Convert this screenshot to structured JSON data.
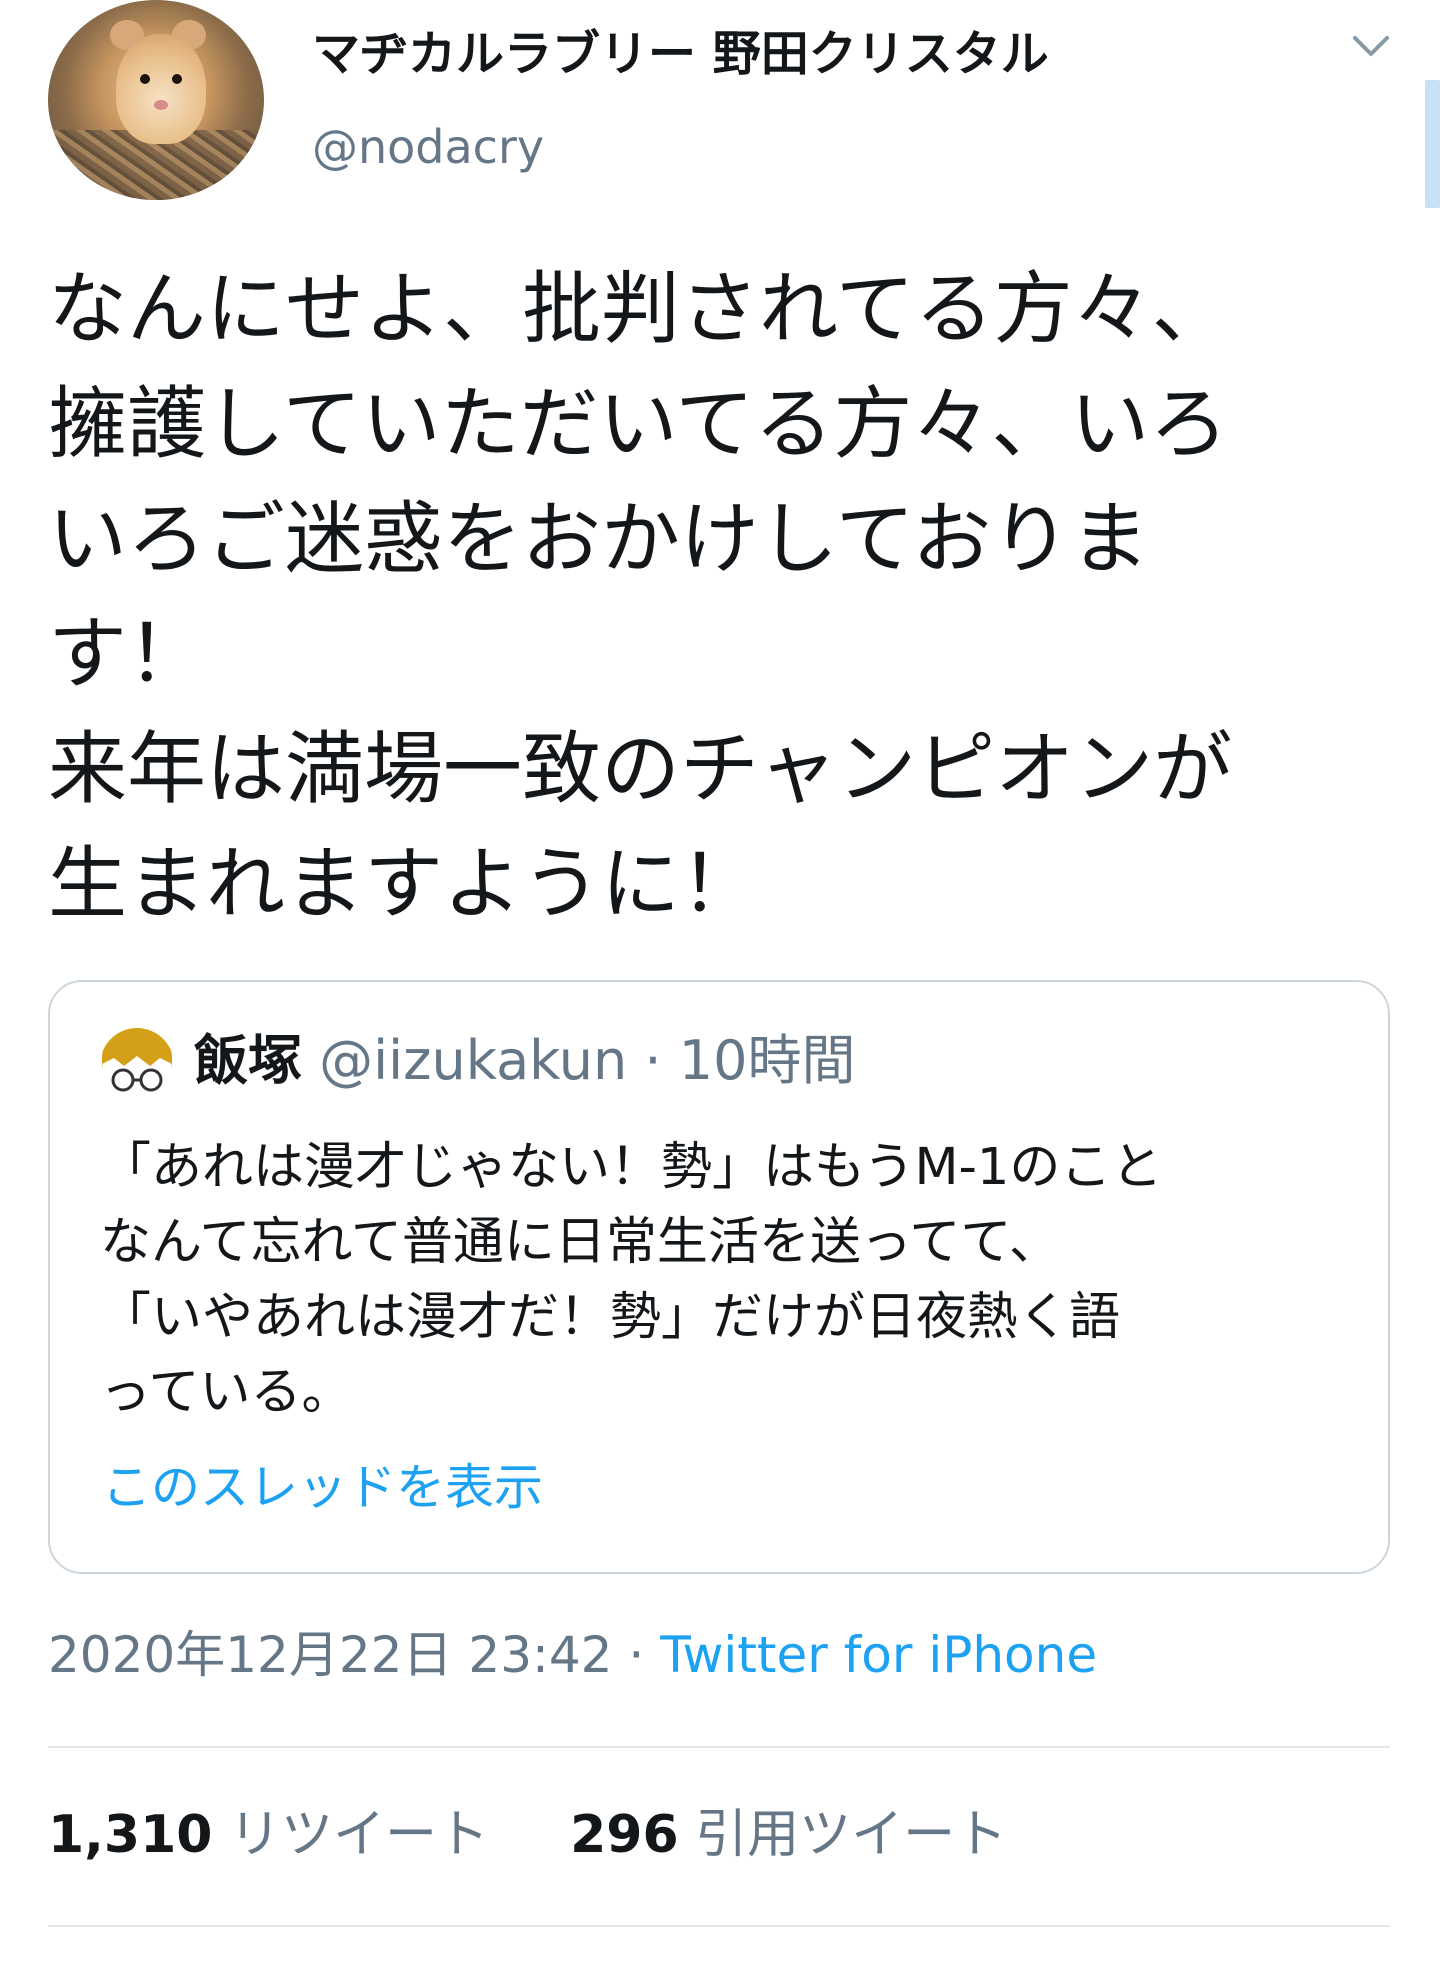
{
  "author": {
    "display_name": "マヂカルラブリー 野田クリスタル",
    "handle": "@nodacry",
    "avatar_icon": "hamster-avatar"
  },
  "menu": {
    "icon": "chevron-down-icon"
  },
  "tweet": {
    "text": "なんにせよ、批判されてる方々、\n擁護していただいてる方々、いろ\nいろご迷惑をおかけしておりま\nす！\n来年は満場一致のチャンピオンが\n生まれますように！"
  },
  "quote": {
    "name": "飯塚",
    "handle": "@iizukakun",
    "separator": "·",
    "time": "10時間",
    "text": "「あれは漫才じゃない！勢」はもうM-1のこと\nなんて忘れて普通に日常生活を送ってて、\n「いやあれは漫才だ！勢」だけが日夜熱く語\nっている。",
    "show_thread": "このスレッドを表示",
    "avatar_icon": "glasses-avatar"
  },
  "meta": {
    "datetime": "2020年12月22日 23:42",
    "separator": "·",
    "source": "Twitter for iPhone"
  },
  "stats": {
    "retweets_count": "1,310",
    "retweets_label": "リツイート",
    "quotes_count": "296",
    "quotes_label": "引用ツイート"
  },
  "colors": {
    "link": "#1da1f2",
    "secondary_text": "#657786",
    "primary_text": "#14171a",
    "border": "#e1e8ed"
  }
}
